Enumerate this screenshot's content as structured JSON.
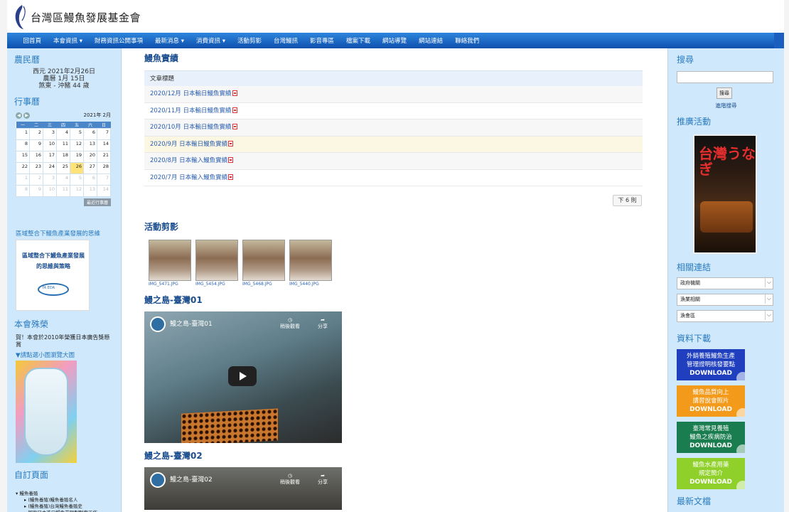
{
  "header": {
    "org_name": "台灣區鰻魚發展基金會"
  },
  "nav": {
    "items": [
      "回首頁",
      "本會資訊 ▾",
      "財務資訊公開事項",
      "最新消息 ▾",
      "消費資訊 ▾",
      "活動剪影",
      "台灣鰻訊",
      "影音專區",
      "檔案下載",
      "網站導覽",
      "網站連結",
      "聯絡我們"
    ]
  },
  "left": {
    "lunar_title": "農民曆",
    "lunar_line1": "西元 2021年2月26日",
    "lunar_line2": "農曆 1月 15日",
    "lunar_line3": "煞東 - 沖豬 44 歲",
    "events_title": "行事曆",
    "cal_month": "2021年 2月",
    "cal_weekdays": [
      "一",
      "二",
      "三",
      "四",
      "五",
      "六",
      "日"
    ],
    "cal_rows": [
      [
        "1",
        "2",
        "3",
        "4",
        "5",
        "6",
        "7"
      ],
      [
        "8",
        "9",
        "10",
        "11",
        "12",
        "13",
        "14"
      ],
      [
        "15",
        "16",
        "17",
        "18",
        "19",
        "20",
        "21"
      ],
      [
        "22",
        "23",
        "24",
        "25",
        "26",
        "27",
        "28"
      ],
      [
        "1",
        "2",
        "3",
        "4",
        "5",
        "6",
        "7"
      ],
      [
        "8",
        "9",
        "10",
        "11",
        "12",
        "13",
        "14"
      ]
    ],
    "cal_more": "最近行事曆",
    "promo_title": "區域整合下鰻魚產業發展的思維",
    "promo_img_line1": "區域整合下鰻魚產業發展",
    "promo_img_line2": "的思維與策略",
    "promo_img_org": "TA EDA",
    "honor_title": "本會殊榮",
    "honor_text": "賀！本會於2010年榮獲日本廣告獎懸賞",
    "honor_link": "▼請點選小圖瀏覽大圖",
    "custom_title": "自訂頁面",
    "tree": [
      "鰻魚養殖",
      "(鰻魚養殖)鰻魚養殖名人",
      "(鰻魚養殖)台灣鰻魚養殖史",
      "回復日本進口鰻魚苗限制制定工作"
    ]
  },
  "main": {
    "results_title": "鰻魚實績",
    "col_header": "文章標題",
    "rows": [
      "2020/12月 日本輸日鰻魚實績",
      "2020/11月 日本輸日鰻魚實績",
      "2020/10月 日本輸日鰻魚實績",
      "2020/9月 日本輸日鰻魚實績",
      "2020/8月 日本輸入鰻魚實績",
      "2020/7月 日本輸入鰻魚實績"
    ],
    "next_label": "下 6 則",
    "activity_title": "活動剪影",
    "thumbs": [
      "IMG_5471.JPG",
      "IMG_5454.JPG",
      "IMG_5468.JPG",
      "IMG_5440.JPG"
    ],
    "video1_title": "鰻之島-臺灣01",
    "video1_caption": "鰻之島-臺灣01",
    "video2_title": "鰻之島-臺灣02",
    "video2_caption": "鰻之島-臺灣02",
    "watch_later": "稍後觀看",
    "share": "分享"
  },
  "right": {
    "search_title": "搜尋",
    "search_btn": "搜尋",
    "adv_search": "進階搜尋",
    "promo_title": "推廣活動",
    "promo_big": "台灣うなぎ",
    "links_title": "相關連結",
    "selects": [
      "政府機關",
      "漁業相關",
      "漁會區"
    ],
    "download_title": "資料下載",
    "downloads": [
      {
        "line1": "外銷養殖鰻魚生產",
        "line2": "管理證明核發要點",
        "btn": "DOWNLOAD",
        "color": "#1f3fbf"
      },
      {
        "line1": "鰻魚品質向上",
        "line2": "講習說會照片",
        "btn": "DOWNLOAD",
        "color": "#f39a1a"
      },
      {
        "line1": "臺灣常見養殖",
        "line2": "鰻魚之疾病防治",
        "btn": "DOWNLOAD",
        "color": "#1a7d4f"
      },
      {
        "line1": "鰻魚水產用藥",
        "line2": "規定簡介",
        "btn": "DOWNLOAD",
        "color": "#8fd12a"
      }
    ],
    "latest_title": "最新文檔"
  }
}
